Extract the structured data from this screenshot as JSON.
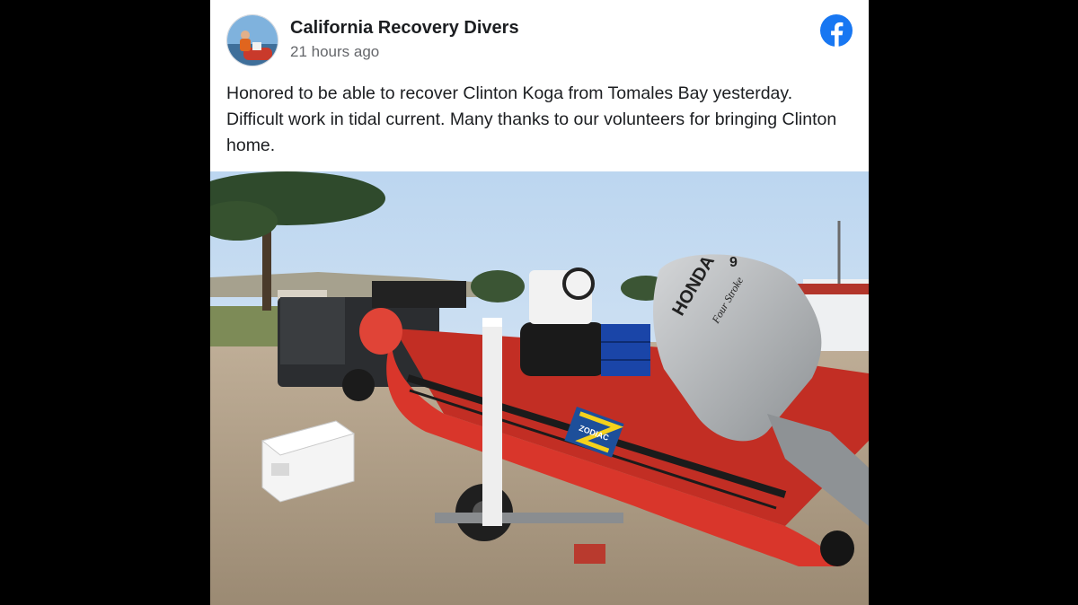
{
  "post": {
    "author": "California Recovery Divers",
    "timestamp": "21 hours ago",
    "caption": "Honored to be able to recover Clinton Koga from Tomales Bay yesterday. Difficult work in tidal current. Many thanks to our volunteers for bringing Clinton home.",
    "platform_icon": "facebook-icon",
    "photo": {
      "outboard_brand": "HONDA",
      "outboard_model": "Four Stroke",
      "outboard_number": "9",
      "boat_brand": "ZODIAC"
    }
  },
  "colors": {
    "background": "#000000",
    "card": "#ffffff",
    "author_text": "#1c1e21",
    "meta_text": "#65676b",
    "facebook_blue": "#1877f2",
    "boat_red": "#d9362b"
  }
}
